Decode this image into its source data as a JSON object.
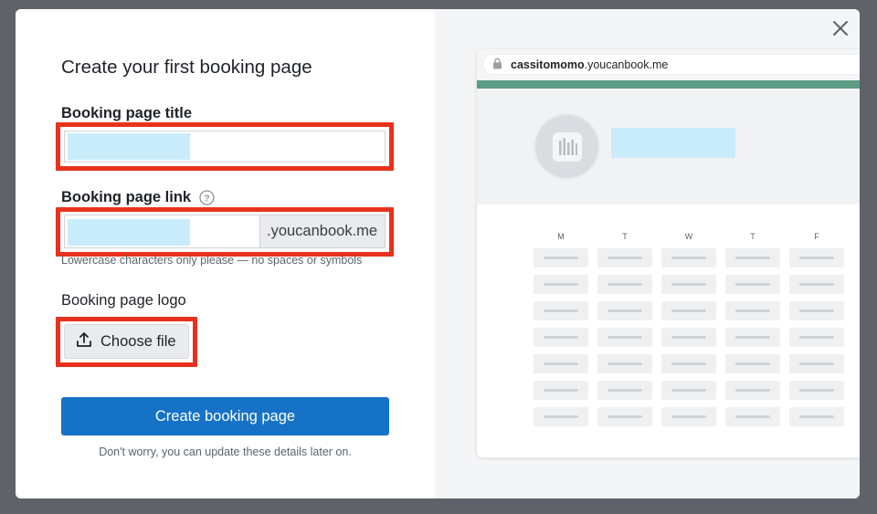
{
  "modal": {
    "title": "Create your first booking page",
    "close_icon": "close-icon",
    "fields": {
      "title_label": "Booking page title",
      "title_value": "",
      "link_label": "Booking page link",
      "link_value": "",
      "link_suffix": ".youcanbook.me",
      "link_hint": "Lowercase characters only please — no spaces or symbols",
      "logo_label": "Booking page logo",
      "choose_file_label": "Choose file"
    },
    "cta_label": "Create booking page",
    "footnote": "Don't worry, you can update these details later on."
  },
  "preview": {
    "url_subdomain": "cassitomomo",
    "url_domain": ".youcanbook.me",
    "accent_color": "#5b9c84",
    "highlight_color": "#c9ecfb",
    "days": [
      "M",
      "T",
      "W",
      "T",
      "F"
    ],
    "rows_per_day": 7
  },
  "colors": {
    "primary": "#1672c7",
    "annotation": "#e8321d"
  }
}
